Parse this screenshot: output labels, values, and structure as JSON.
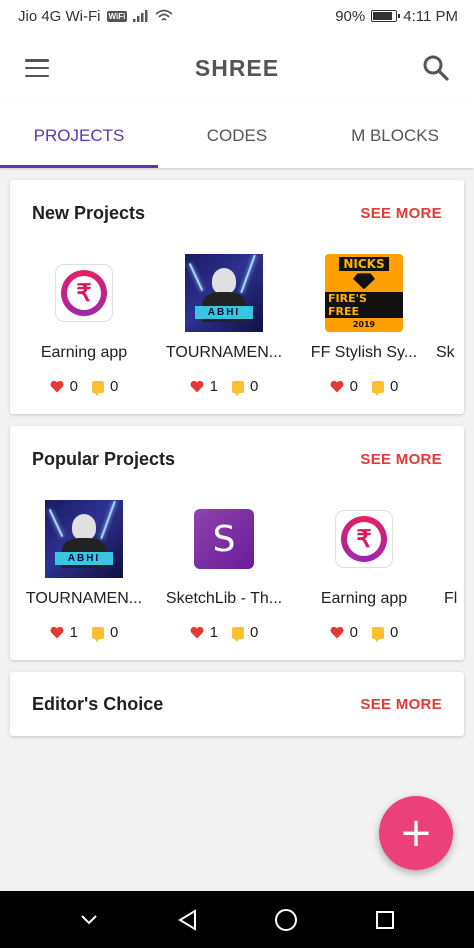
{
  "status_bar": {
    "carrier": "Jio 4G Wi-Fi",
    "wifi_badge": "WiFi",
    "battery_percent": "90%",
    "battery_level": 0.9,
    "time": "4:11 PM"
  },
  "app_bar": {
    "title": "SHREE"
  },
  "tabs": [
    {
      "label": "PROJECTS",
      "active": true
    },
    {
      "label": "CODES",
      "active": false
    },
    {
      "label": "M BLOCKS",
      "active": false
    }
  ],
  "sections": {
    "new_projects": {
      "title": "New Projects",
      "see_more": "SEE MORE",
      "items": [
        {
          "name": "Earning app",
          "likes": "0",
          "comments": "0",
          "icon": "rupee-app-icon"
        },
        {
          "name": "TOURNAMEN...",
          "likes": "1",
          "comments": "0",
          "icon": "abhi-avatar-icon",
          "icon_text": "ABHI"
        },
        {
          "name": "FF Stylish Sy...",
          "likes": "0",
          "comments": "0",
          "icon": "nicks-fires-free-icon",
          "icon_lines": [
            "NICKS",
            "FIRE'S FREE",
            "2019"
          ]
        },
        {
          "name": "Sk"
        }
      ]
    },
    "popular_projects": {
      "title": "Popular Projects",
      "see_more": "SEE MORE",
      "items": [
        {
          "name": "TOURNAMEN...",
          "likes": "1",
          "comments": "0",
          "icon": "abhi-avatar-icon",
          "icon_text": "ABHI"
        },
        {
          "name": "SketchLib - Th...",
          "likes": "1",
          "comments": "0",
          "icon": "sketchlib-icon",
          "icon_letter": "S"
        },
        {
          "name": "Earning app",
          "likes": "0",
          "comments": "0",
          "icon": "rupee-app-icon"
        },
        {
          "name": "Fl"
        }
      ]
    },
    "editors_choice": {
      "title": "Editor's Choice",
      "see_more": "SEE MORE"
    }
  },
  "fab": {
    "label": "+"
  },
  "colors": {
    "accent": "#5e35b1",
    "see_more": "#e53935",
    "fab": "#ec407a",
    "heart": "#e53935",
    "comment": "#fbc02d"
  }
}
